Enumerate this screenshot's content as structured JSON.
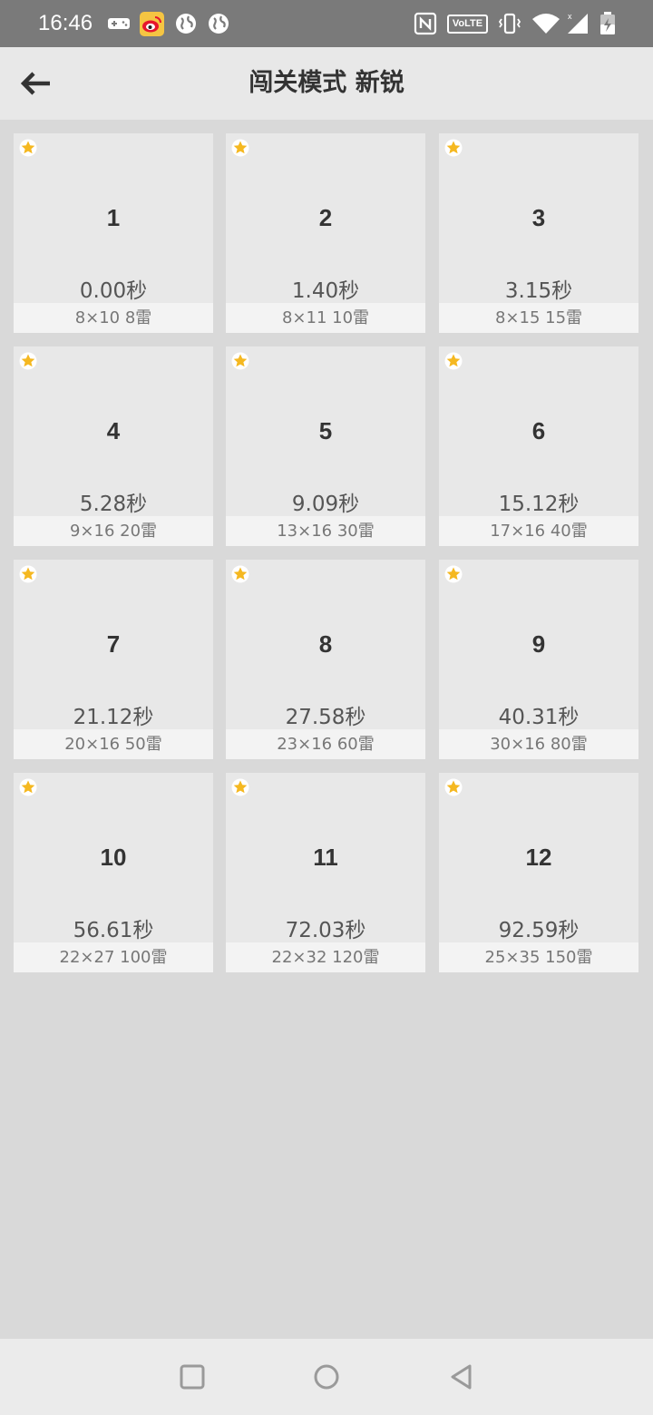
{
  "status_bar": {
    "time": "16:46",
    "left_icons": [
      "gamepad-icon",
      "weibo-icon",
      "globe-icon",
      "globe-icon"
    ],
    "right_icons": [
      "nfc-icon",
      "volte-icon",
      "vibrate-icon",
      "wifi-icon",
      "signal-icon",
      "battery-icon"
    ],
    "volte_label": "VoLTE"
  },
  "app_bar": {
    "back_icon": "arrow-left-icon",
    "title": "闯关模式 新锐"
  },
  "levels": [
    {
      "number": "1",
      "time": "0.00秒",
      "info": "8×10  8雷"
    },
    {
      "number": "2",
      "time": "1.40秒",
      "info": "8×11  10雷"
    },
    {
      "number": "3",
      "time": "3.15秒",
      "info": "8×15  15雷"
    },
    {
      "number": "4",
      "time": "5.28秒",
      "info": "9×16  20雷"
    },
    {
      "number": "5",
      "time": "9.09秒",
      "info": "13×16  30雷"
    },
    {
      "number": "6",
      "time": "15.12秒",
      "info": "17×16  40雷"
    },
    {
      "number": "7",
      "time": "21.12秒",
      "info": "20×16  50雷"
    },
    {
      "number": "8",
      "time": "27.58秒",
      "info": "23×16  60雷"
    },
    {
      "number": "9",
      "time": "40.31秒",
      "info": "30×16  80雷"
    },
    {
      "number": "10",
      "time": "56.61秒",
      "info": "22×27  100雷"
    },
    {
      "number": "11",
      "time": "72.03秒",
      "info": "22×32  120雷"
    },
    {
      "number": "12",
      "time": "92.59秒",
      "info": "25×35  150雷"
    }
  ],
  "colors": {
    "star": "#f5b820",
    "status_bar": "#7a7a7a",
    "app_bar": "#e8e8e8",
    "background": "#d9d9d9",
    "card": "#e8e8e8"
  },
  "nav_bar": {
    "icons": [
      "recents-square-icon",
      "home-circle-icon",
      "back-triangle-icon"
    ]
  }
}
